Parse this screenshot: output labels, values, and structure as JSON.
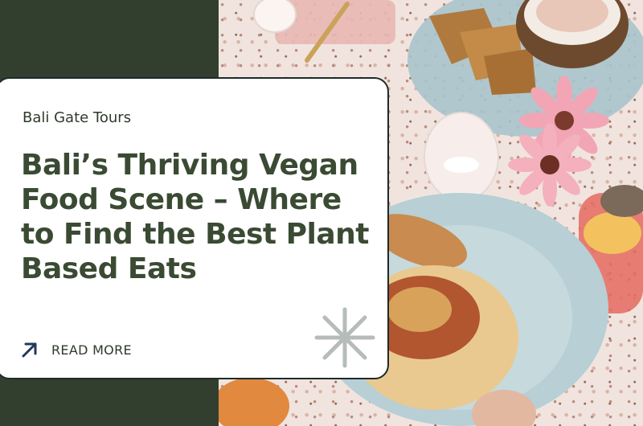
{
  "card": {
    "category": "Bali Gate Tours",
    "title": "Bali’s Thriving Vegan Food Scene – Where to Find the Best Plant Based Eats",
    "read_more_label": "READ MORE"
  },
  "icons": {
    "read_more": "arrow-up-right-icon",
    "decoration": "sparkle-icon"
  },
  "colors": {
    "page_background": "#323f2e",
    "title": "#3a4a33",
    "card_background": "#ffffff"
  }
}
